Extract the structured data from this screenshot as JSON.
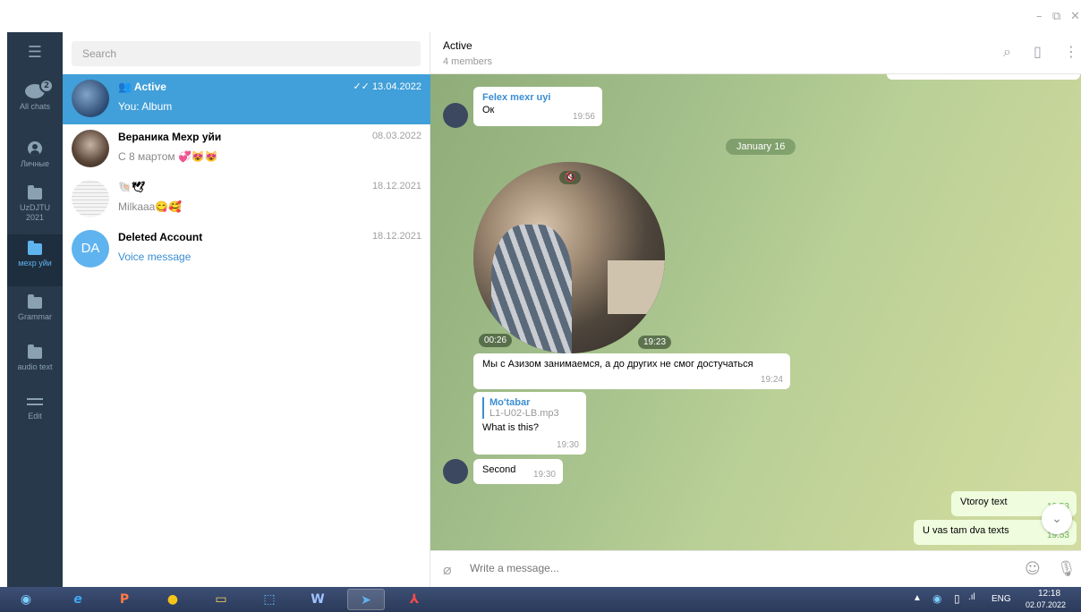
{
  "window": {
    "minimize": "–",
    "restore": "⧉",
    "close": "✕"
  },
  "folders": [
    {
      "label": "All chats",
      "icon": "chats-icon",
      "badge": "2"
    },
    {
      "label": "Личные",
      "icon": "person-icon"
    },
    {
      "label": "UzDJTU 2021",
      "icon": "folder-icon"
    },
    {
      "label": "мехр уйи",
      "icon": "folder-icon",
      "active": true
    },
    {
      "label": "Grammar",
      "icon": "folder-icon"
    },
    {
      "label": "audio text",
      "icon": "folder-icon"
    },
    {
      "label": "Edit",
      "icon": "edit-icon"
    }
  ],
  "chatlist": {
    "search_placeholder": "Search",
    "chats": [
      {
        "name": "Active",
        "preview": "You: Album",
        "date": "13.04.2022",
        "selected": true,
        "read": "✓✓"
      },
      {
        "name": "Вераника Мехр уйи",
        "preview": "С 8 мартом 💞😻😻",
        "date": "08.03.2022"
      },
      {
        "name": "🐚🕊",
        "preview": "Milkaaa😋🥰",
        "date": "18.12.2021"
      },
      {
        "name": "Deleted Account",
        "preview": "Voice message",
        "date": "18.12.2021",
        "initials": "DA"
      }
    ]
  },
  "header": {
    "title": "Active",
    "subtitle": "4 members"
  },
  "messages": {
    "m1": {
      "sender": "Felex mexr uyi",
      "text": "Ок",
      "time": "19:56"
    },
    "date_divider": "January 16",
    "video": {
      "duration": "00:26",
      "time": "19:23"
    },
    "m2": {
      "text": "Мы с Азизом занимаемся, а до других не смог достучаться",
      "time": "19:24"
    },
    "m3": {
      "reply_name": "Mo'tabar",
      "reply_file": "L1-U02-LB.mp3",
      "text": "What is this?",
      "time": "19:30"
    },
    "m4": {
      "text": "Second",
      "time": "19:30"
    },
    "m5": {
      "text": "Vtoroy text",
      "time": "19:53"
    },
    "m6": {
      "text": "U vas tam dva texts",
      "time": "19:53"
    }
  },
  "composer": {
    "placeholder": "Write a message..."
  },
  "taskbar": {
    "apps": [
      {
        "name": "taskbar-start-button",
        "glyph": "◉"
      },
      {
        "name": "taskbar-ie",
        "glyph": "e"
      },
      {
        "name": "taskbar-powerpoint",
        "glyph": "P"
      },
      {
        "name": "taskbar-chrome",
        "glyph": "●"
      },
      {
        "name": "taskbar-explorer",
        "glyph": "▭"
      },
      {
        "name": "taskbar-snipping",
        "glyph": "⬚"
      },
      {
        "name": "taskbar-word",
        "glyph": "W"
      },
      {
        "name": "taskbar-telegram",
        "glyph": "➤"
      },
      {
        "name": "taskbar-acrobat",
        "glyph": "⅄"
      }
    ],
    "lang": "ENG",
    "clock_time": "12:18",
    "clock_date": "02.07.2022"
  },
  "colors": {
    "accent": "#419fd9",
    "rail": "#27394b",
    "outgoing": "#effdde"
  }
}
